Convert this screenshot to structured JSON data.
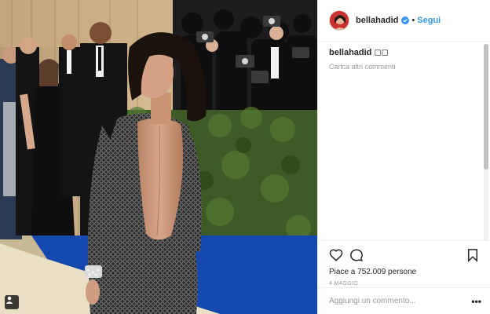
{
  "post": {
    "username": "bellahadid",
    "follow_label": "Segui",
    "separator": "•",
    "caption_user": "bellahadid",
    "caption_text": "◻◻",
    "load_more_label": "Carica altri commenti",
    "likes_text": "Piace a 752.009 persone",
    "date_text": "4 MAGGIO",
    "comment_placeholder": "Aggiungi un commento...",
    "more_label": "•••"
  },
  "icons": {
    "verified": "verified-badge-icon",
    "like": "heart-icon",
    "comment": "speech-bubble-icon",
    "save": "bookmark-icon",
    "user_tag": "person-tag-icon"
  },
  "colors": {
    "accent": "#3897f0",
    "text": "#262626",
    "muted": "#999999",
    "border": "#efefef"
  }
}
